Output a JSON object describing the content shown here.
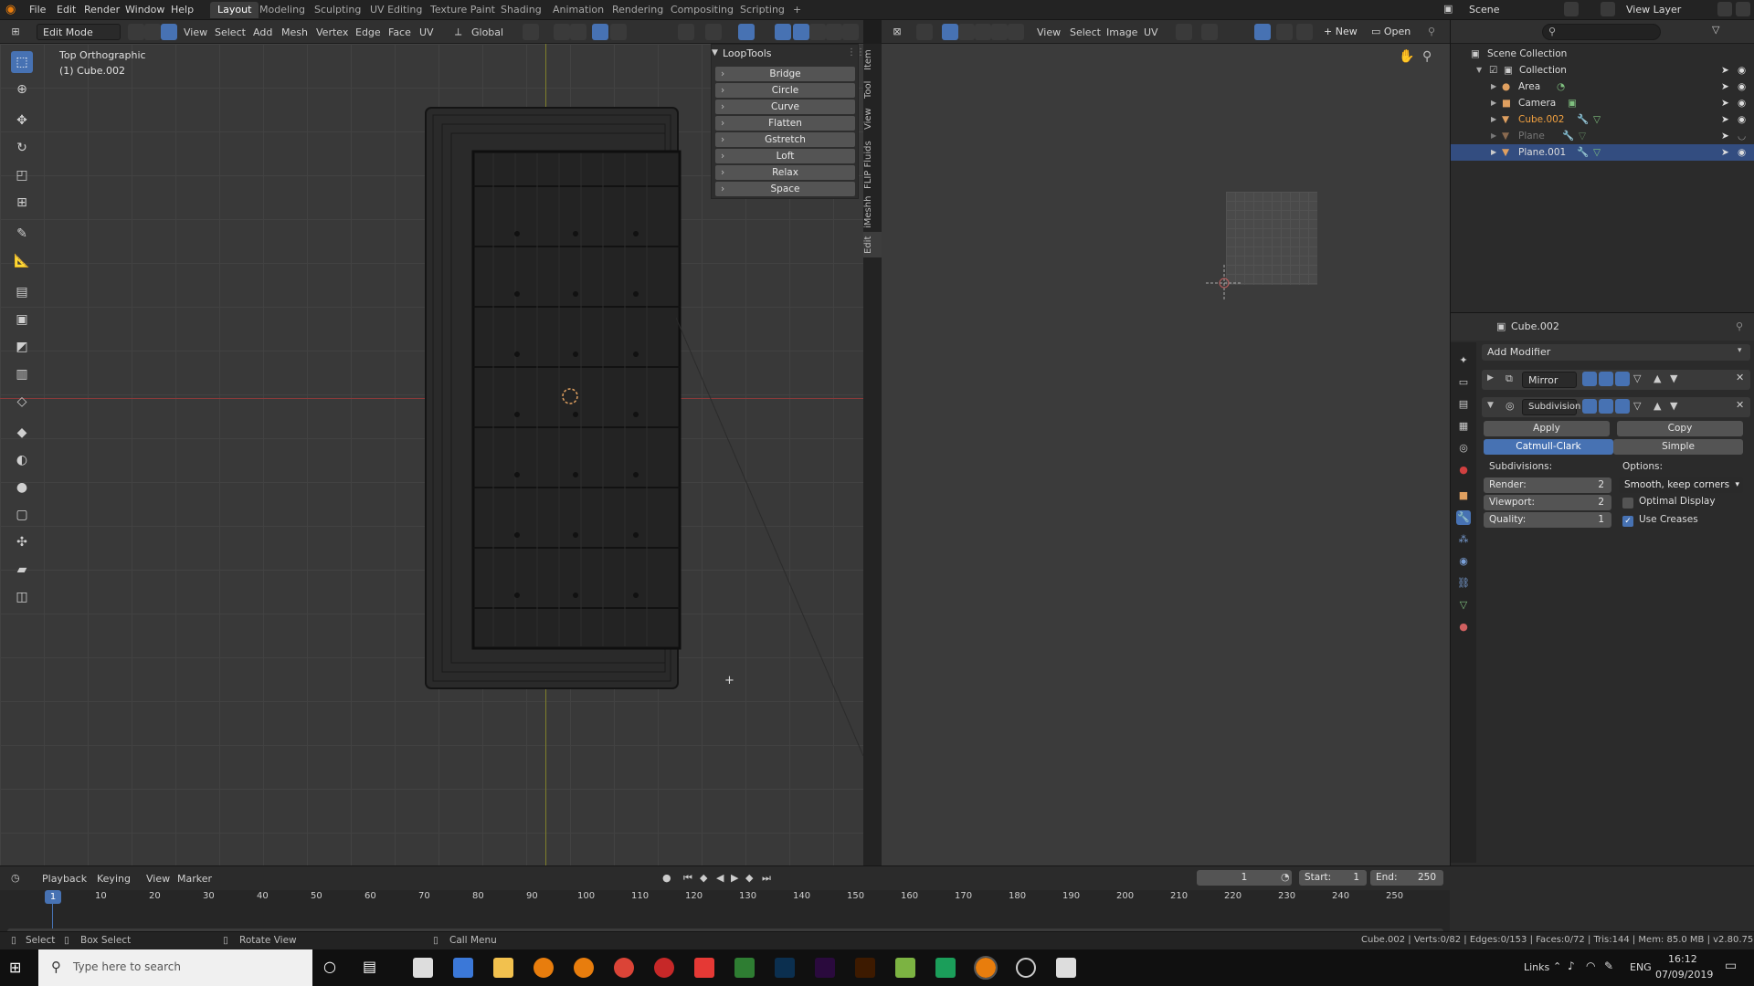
{
  "menu": {
    "file": "File",
    "edit": "Edit",
    "render": "Render",
    "window": "Window",
    "help": "Help"
  },
  "workspaces": [
    "Layout",
    "Modeling",
    "Sculpting",
    "UV Editing",
    "Texture Paint",
    "Shading",
    "Animation",
    "Rendering",
    "Compositing",
    "Scripting"
  ],
  "workspace_add": "+",
  "scene": {
    "label": "Scene",
    "view_layer": "View Layer"
  },
  "viewport_header": {
    "mode": "Edit Mode",
    "menus": [
      "View",
      "Select",
      "Add",
      "Mesh",
      "Vertex",
      "Edge",
      "Face",
      "UV"
    ],
    "orientation": "Global"
  },
  "viewport": {
    "title": "Top Orthographic",
    "object": "(1) Cube.002"
  },
  "looptools": {
    "title": "LoopTools",
    "items": [
      "Bridge",
      "Circle",
      "Curve",
      "Flatten",
      "Gstretch",
      "Loft",
      "Relax",
      "Space"
    ]
  },
  "side_tabs": [
    "Item",
    "Tool",
    "View",
    "FLIP Fluids",
    "iMeshh",
    "Edit"
  ],
  "uv_header": {
    "menus": [
      "View",
      "Select",
      "Image",
      "UV"
    ],
    "new": "New",
    "open": "Open"
  },
  "outliner": {
    "items": [
      {
        "name": "Scene Collection"
      },
      {
        "name": "Collection"
      },
      {
        "name": "Area"
      },
      {
        "name": "Camera"
      },
      {
        "name": "Cube.002"
      },
      {
        "name": "Plane"
      },
      {
        "name": "Plane.001"
      }
    ]
  },
  "properties": {
    "object": "Cube.002",
    "add_modifier": "Add Modifier",
    "mod1": "Mirror",
    "mod2": "Subdivision",
    "apply": "Apply",
    "copy": "Copy",
    "catmull": "Catmull-Clark",
    "simple": "Simple",
    "subdivisions": "Subdivisions:",
    "options": "Options:",
    "render_label": "Render:",
    "render_val": "2",
    "viewport_label": "Viewport:",
    "viewport_val": "2",
    "quality_label": "Quality:",
    "quality_val": "1",
    "uv_smooth": "Smooth, keep corners",
    "optimal": "Optimal Display",
    "use_creases": "Use Creases"
  },
  "timeline": {
    "menus": [
      "Playback",
      "Keying",
      "View",
      "Marker"
    ],
    "current": "1",
    "start_label": "Start:",
    "start": "1",
    "end_label": "End:",
    "end": "250",
    "ticks": [
      "10",
      "20",
      "30",
      "40",
      "50",
      "60",
      "70",
      "80",
      "90",
      "100",
      "110",
      "120",
      "130",
      "140",
      "150",
      "160",
      "170",
      "180",
      "190",
      "200",
      "210",
      "220",
      "230",
      "240",
      "250"
    ],
    "frame_marker": "1"
  },
  "status": {
    "select": "Select",
    "box_select": "Box Select",
    "rotate": "Rotate View",
    "call_menu": "Call Menu",
    "stats": "Cube.002 | Verts:0/82 | Edges:0/153 | Faces:0/72 | Tris:144 | Mem: 85.0 MB | v2.80.75"
  },
  "taskbar": {
    "search": "Type here to search",
    "links": "Links",
    "lang": "ENG",
    "time": "16:12",
    "date": "07/09/2019"
  },
  "colors": {
    "accent": "#4772b3",
    "selected_row": "#334d80",
    "x_axis": "#8a3a3a",
    "y_axis": "#7f7f2a"
  }
}
